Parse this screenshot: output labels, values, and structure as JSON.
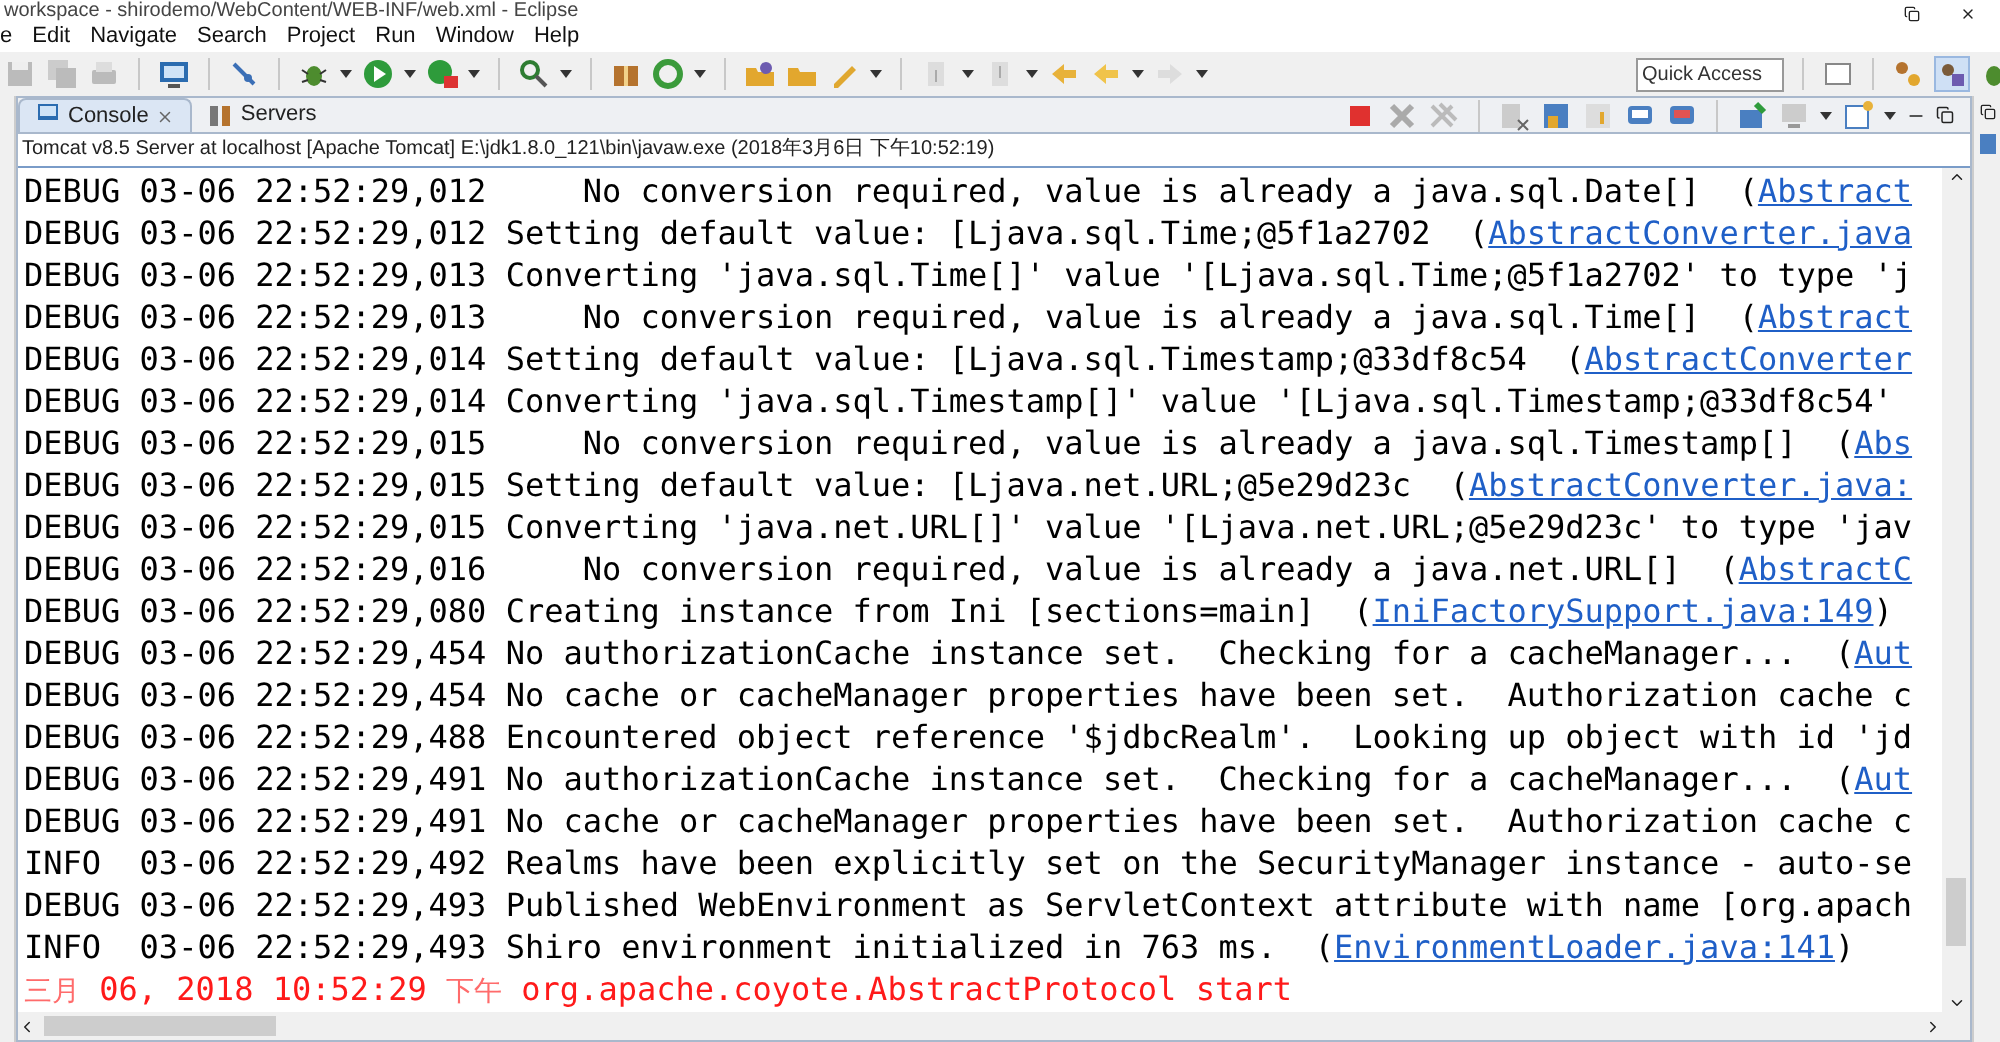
{
  "window": {
    "title": "workspace - shirodemo/WebContent/WEB-INF/web.xml - Eclipse"
  },
  "menu": [
    "e",
    "Edit",
    "Navigate",
    "Search",
    "Project",
    "Run",
    "Window",
    "Help"
  ],
  "quick_access": {
    "placeholder": "Quick Access"
  },
  "tabs": [
    {
      "label": "Console",
      "selected": true,
      "closable": true
    },
    {
      "label": "Servers",
      "selected": false,
      "closable": false
    }
  ],
  "console": {
    "header": "Tomcat v8.5 Server at localhost [Apache Tomcat] E:\\jdk1.8.0_121\\bin\\javaw.exe (2018年3月6日 下午10:52:19)",
    "lines": [
      {
        "kind": "log",
        "text": "DEBUG 03-06 22:52:29,012     No conversion required, value is already a java.sql.Date[]  (",
        "link": "Abstract"
      },
      {
        "kind": "log",
        "text": "DEBUG 03-06 22:52:29,012 Setting default value: [Ljava.sql.Time;@5f1a2702  (",
        "link": "AbstractConverter.java"
      },
      {
        "kind": "log",
        "text": "DEBUG 03-06 22:52:29,013 Converting 'java.sql.Time[]' value '[Ljava.sql.Time;@5f1a2702' to type 'j"
      },
      {
        "kind": "log",
        "text": "DEBUG 03-06 22:52:29,013     No conversion required, value is already a java.sql.Time[]  (",
        "link": "Abstract"
      },
      {
        "kind": "log",
        "text": "DEBUG 03-06 22:52:29,014 Setting default value: [Ljava.sql.Timestamp;@33df8c54  (",
        "link": "AbstractConverter"
      },
      {
        "kind": "log",
        "text": "DEBUG 03-06 22:52:29,014 Converting 'java.sql.Timestamp[]' value '[Ljava.sql.Timestamp;@33df8c54'"
      },
      {
        "kind": "log",
        "text": "DEBUG 03-06 22:52:29,015     No conversion required, value is already a java.sql.Timestamp[]  (",
        "link": "Abs"
      },
      {
        "kind": "log",
        "text": "DEBUG 03-06 22:52:29,015 Setting default value: [Ljava.net.URL;@5e29d23c  (",
        "link": "AbstractConverter.java:"
      },
      {
        "kind": "log",
        "text": "DEBUG 03-06 22:52:29,015 Converting 'java.net.URL[]' value '[Ljava.net.URL;@5e29d23c' to type 'jav"
      },
      {
        "kind": "log",
        "text": "DEBUG 03-06 22:52:29,016     No conversion required, value is already a java.net.URL[]  (",
        "link": "AbstractC"
      },
      {
        "kind": "log",
        "text": "DEBUG 03-06 22:52:29,080 Creating instance from Ini [sections=main]  (",
        "link": "IniFactorySupport.java:149",
        "tail": ")"
      },
      {
        "kind": "log",
        "text": "DEBUG 03-06 22:52:29,454 No authorizationCache instance set.  Checking for a cacheManager...  (",
        "link": "Aut"
      },
      {
        "kind": "log",
        "text": "DEBUG 03-06 22:52:29,454 No cache or cacheManager properties have been set.  Authorization cache c"
      },
      {
        "kind": "log",
        "text": "DEBUG 03-06 22:52:29,488 Encountered object reference '$jdbcRealm'.  Looking up object with id 'jd"
      },
      {
        "kind": "log",
        "text": "DEBUG 03-06 22:52:29,491 No authorizationCache instance set.  Checking for a cacheManager...  (",
        "link": "Aut"
      },
      {
        "kind": "log",
        "text": "DEBUG 03-06 22:52:29,491 No cache or cacheManager properties have been set.  Authorization cache c"
      },
      {
        "kind": "log",
        "text": "INFO  03-06 22:52:29,492 Realms have been explicitly set on the SecurityManager instance - auto-se"
      },
      {
        "kind": "log",
        "text": "DEBUG 03-06 22:52:29,493 Published WebEnvironment as ServletContext attribute with name [org.apach"
      },
      {
        "kind": "log",
        "text": "INFO  03-06 22:52:29,493 Shiro environment initialized in 763 ms.  (",
        "link": "EnvironmentLoader.java:141",
        "tail": ")"
      },
      {
        "kind": "error",
        "parts": [
          "三月",
          " 06, 2018 10:52:29 ",
          "下午",
          " org.apache.coyote.AbstractProtocol start"
        ]
      }
    ]
  }
}
